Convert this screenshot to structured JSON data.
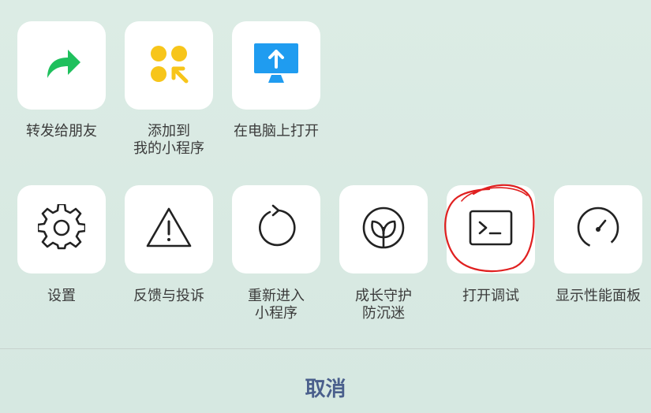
{
  "row1": [
    {
      "label": "转发给朋友",
      "icon": "share-arrow-icon"
    },
    {
      "label": "添加到\n我的小程序",
      "icon": "add-miniprogram-icon"
    },
    {
      "label": "在电脑上打开",
      "icon": "open-on-computer-icon"
    }
  ],
  "row2": [
    {
      "label": "设置",
      "icon": "gear-icon"
    },
    {
      "label": "反馈与投诉",
      "icon": "warning-icon"
    },
    {
      "label": "重新进入\n小程序",
      "icon": "refresh-icon"
    },
    {
      "label": "成长守护\n防沉迷",
      "icon": "sprout-icon"
    },
    {
      "label": "打开调试",
      "icon": "terminal-icon"
    },
    {
      "label": "显示性能面板",
      "icon": "gauge-icon"
    }
  ],
  "cancel_label": "取消",
  "colors": {
    "share_green": "#1fc05d",
    "dot_yellow": "#f7c51a",
    "computer_blue": "#1f9cf0",
    "annotation_red": "#e02020",
    "cancel_text": "#4a5f8c"
  }
}
